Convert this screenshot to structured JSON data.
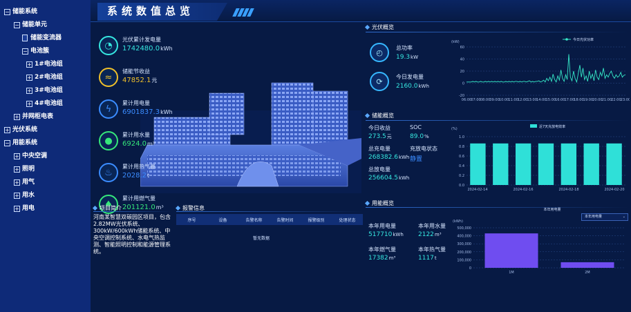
{
  "sidebar": {
    "items": [
      {
        "label": "储能系统",
        "level": 0,
        "marker": "−"
      },
      {
        "label": "储能单元",
        "level": 1,
        "marker": "−"
      },
      {
        "label": "储能变流器",
        "level": 2,
        "marker": "doc"
      },
      {
        "label": "电池簇",
        "level": 2,
        "marker": "−"
      },
      {
        "label": "1#电池组",
        "level": 3,
        "marker": "+"
      },
      {
        "label": "2#电池组",
        "level": 3,
        "marker": "+"
      },
      {
        "label": "3#电池组",
        "level": 3,
        "marker": "+"
      },
      {
        "label": "4#电池组",
        "level": 3,
        "marker": "+"
      },
      {
        "label": "并网柜电表",
        "level": 1,
        "marker": "+"
      },
      {
        "label": "光伏系统",
        "level": 0,
        "marker": "+"
      },
      {
        "label": "用能系统",
        "level": 0,
        "marker": "−"
      },
      {
        "label": "中央空调",
        "level": 1,
        "marker": "+"
      },
      {
        "label": "照明",
        "level": 1,
        "marker": "+"
      },
      {
        "label": "用气",
        "level": 1,
        "marker": "+"
      },
      {
        "label": "用水",
        "level": 1,
        "marker": "+"
      },
      {
        "label": "用电",
        "level": 1,
        "marker": "+"
      }
    ]
  },
  "header": {
    "title": "系统数值总览"
  },
  "metrics": [
    {
      "label": "光伏累计发电量",
      "value": "1742480.0",
      "unit": "kWh",
      "color": "#36e8e0",
      "icon": "gauge-icon"
    },
    {
      "label": "储能节收益",
      "value": "47852.1",
      "unit": "元",
      "color": "#f0c02a",
      "icon": "coin-icon"
    },
    {
      "label": "累计用电量",
      "value": "6901837.3",
      "unit": "kWh",
      "color": "#3b8cff",
      "icon": "lightning-icon"
    },
    {
      "label": "累计用水量",
      "value": "6924.0",
      "unit": "m³",
      "color": "#36e87a",
      "icon": "water-drop-icon"
    },
    {
      "label": "累计用热气量",
      "value": "2028.2",
      "unit": "t",
      "color": "#3b8cff",
      "icon": "flame-icon"
    },
    {
      "label": "累计用燃气量",
      "value": "201121.0",
      "unit": "m³",
      "color": "#36e87a",
      "icon": "gas-drop-icon"
    }
  ],
  "pv_panel": {
    "title": "光伏概览",
    "power_label": "总功率",
    "power_value": "19.3",
    "power_unit": "kW",
    "today_label": "今日发电量",
    "today_value": "2160.0",
    "today_unit": "kWh"
  },
  "storage_panel": {
    "title": "储能概览",
    "income_label": "今日收益",
    "income_value": "273.5",
    "income_unit": "元",
    "soc_label": "SOC",
    "soc_value": "89.0",
    "soc_unit": "%",
    "charge_label": "总充电量",
    "charge_value": "268382.6",
    "charge_unit": "kWh",
    "state_label": "充放电状态",
    "state_value": "静置",
    "discharge_label": "总放电量",
    "discharge_value": "256604.5",
    "discharge_unit": "kWh"
  },
  "energy_panel": {
    "title": "用能概览",
    "year_elec_label": "本年用电量",
    "year_elec_value": "517710",
    "year_elec_unit": "kWh",
    "year_water_label": "本年用水量",
    "year_water_value": "2122",
    "year_water_unit": "m³",
    "year_gas_label": "本年燃气量",
    "year_gas_value": "17382",
    "year_gas_unit": "m³",
    "year_heat_label": "本年热气量",
    "year_heat_value": "1117",
    "year_heat_unit": "t",
    "select_value": "本年用电量"
  },
  "project_panel": {
    "title": "项目简介",
    "text": "河南某智慧双碳园区项目，包含2.82MW光伏系统、300kW/600kWh储能系统、中央空调控制系统、水电气热监测、智能照明控制和能源管理系统。"
  },
  "alarm_panel": {
    "title": "报警信息",
    "columns": [
      "序号",
      "设备",
      "告警名称",
      "告警时间",
      "报警级别",
      "处理状态"
    ],
    "empty_text": "暂无数据"
  },
  "chart_data": [
    {
      "type": "line",
      "title": "",
      "ylabel": "(kW)",
      "ylim": [
        -20,
        60
      ],
      "yticks": [
        -20,
        0,
        20,
        40,
        60
      ],
      "x": [
        "06:00",
        "07:00",
        "08:00",
        "09:00",
        "10:00",
        "11:00",
        "12:00",
        "13:00",
        "14:00",
        "15:00",
        "16:00",
        "17:00",
        "18:00",
        "19:00",
        "20:00",
        "21:00",
        "22:00",
        "23:00"
      ],
      "series": [
        {
          "name": "今日光伏功率",
          "color": "#36e8c8",
          "values": [
            2,
            2,
            2,
            2,
            3,
            2,
            3,
            2,
            2,
            3,
            2,
            2,
            3,
            2,
            3,
            2,
            3,
            2,
            3,
            2,
            3,
            2,
            3,
            2,
            2,
            3,
            2,
            3,
            2,
            3,
            2,
            3,
            3,
            2,
            3,
            2,
            3,
            3,
            2,
            3,
            4,
            2,
            3,
            2,
            3,
            3,
            4,
            2,
            3,
            5,
            2,
            8,
            4,
            10,
            3,
            15,
            6,
            2,
            12,
            5,
            22,
            8,
            3,
            14,
            6,
            48,
            10,
            4,
            20,
            8,
            2,
            16,
            30,
            10,
            25,
            6,
            12,
            3,
            20,
            8,
            15,
            4,
            22,
            10,
            6,
            18,
            12,
            25,
            8,
            14,
            10,
            16,
            20,
            12,
            8,
            14,
            10,
            12,
            18,
            10,
            13,
            14
          ]
        }
      ],
      "grid": true,
      "legend": "top"
    },
    {
      "type": "bar",
      "title": "",
      "ylabel": "(%)",
      "ylim": [
        0,
        1.0
      ],
      "yticks": [
        0,
        0.2,
        0.4,
        0.6,
        0.8,
        1.0
      ],
      "categories": [
        "1",
        "2",
        "3",
        "4",
        "5",
        "6",
        "7"
      ],
      "xticks": [
        "2024-02-14",
        "2024-02-16",
        "2024-02-18",
        "2024-02-20"
      ],
      "series": [
        {
          "name": "近7天充放电效率",
          "values": [
            0.86,
            0.86,
            0.86,
            0.86,
            0.86,
            0.86,
            0.86
          ],
          "color": "#2fe0d8"
        }
      ],
      "grid": true,
      "legend": "top"
    },
    {
      "type": "bar",
      "title": "本年用电量",
      "ylabel": "(kWh)",
      "ylim": [
        0,
        500000
      ],
      "yticks": [
        0,
        100000,
        200000,
        300000,
        400000,
        500000
      ],
      "categories": [
        "1M",
        "2M"
      ],
      "series": [
        {
          "name": "本年用电量",
          "values": [
            430000,
            70000
          ],
          "color": "#6f4df0"
        }
      ],
      "grid": true,
      "legend": "none"
    }
  ]
}
